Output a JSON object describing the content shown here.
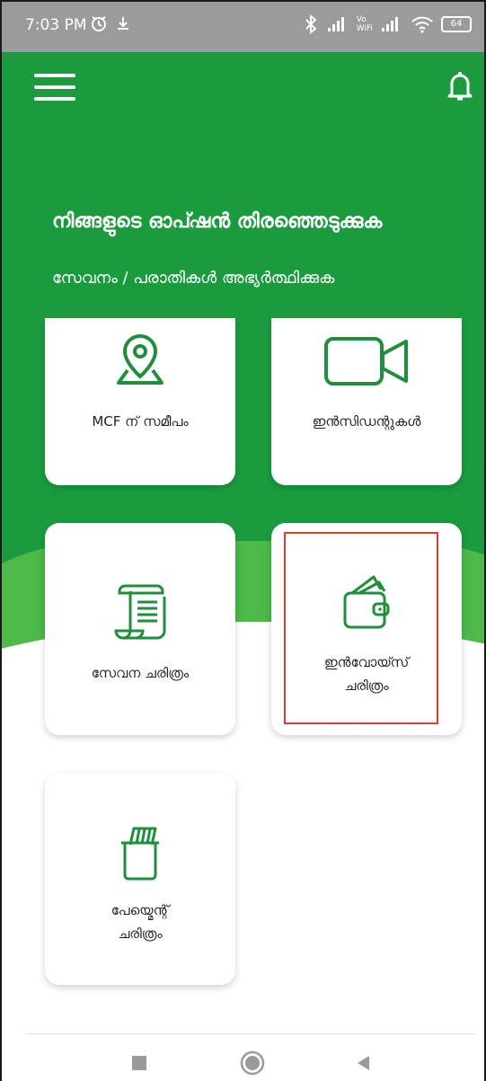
{
  "status_bar": {
    "time": "7:03 PM",
    "battery": "64",
    "volte_top": "Vo",
    "volte_bottom": "WiFi"
  },
  "header": {
    "title": "നിങ്ങളുടെ ഓപ്ഷൻ തിരഞ്ഞെടുക്കുക",
    "subtitle": "സേവനം / പരാതികൾ അഭ്യർത്ഥിക്കുക"
  },
  "cards": [
    {
      "label": "MCF ന് സമീപം",
      "icon": "location-pin-icon"
    },
    {
      "label": "ഇൻസിഡന്റുകൾ",
      "icon": "video-camera-icon"
    },
    {
      "label": "സേവന ചരിത്രം",
      "icon": "scroll-icon"
    },
    {
      "label_line1": "ഇൻവോയ്സ്",
      "label_line2": "ചരിത്രം",
      "icon": "wallet-icon"
    },
    {
      "label_line1": "പേയ്മെന്റ്",
      "label_line2": "ചരിത്രം",
      "icon": "payment-bin-icon"
    }
  ],
  "colors": {
    "primary_green": "#1a9c3e",
    "light_green": "#4cb948",
    "icon_green": "#1e8f3a",
    "highlight_red": "#e53935"
  }
}
